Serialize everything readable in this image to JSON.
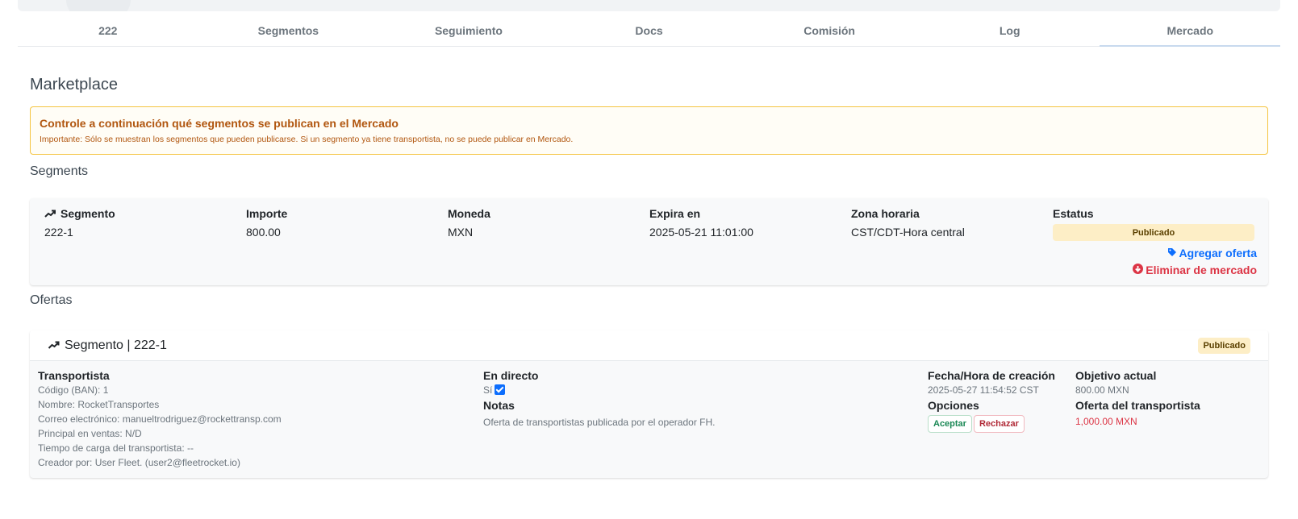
{
  "tabs": [
    "222",
    "Segmentos",
    "Seguimiento",
    "Docs",
    "Comisión",
    "Log",
    "Mercado"
  ],
  "page_title": "Marketplace",
  "alert": {
    "title": "Controle a continuación qué segmentos se publican en el Mercado",
    "subtitle": "Importante: Sólo se muestran los segmentos que pueden publicarse. Si un segmento ya tiene transportista, no se puede publicar en Mercado."
  },
  "segments": {
    "section_label": "Segments",
    "headers": {
      "segmento": "Segmento",
      "importe": "Importe",
      "moneda": "Moneda",
      "expira": "Expira en",
      "zona": "Zona horaria",
      "estatus": "Estatus"
    },
    "row": {
      "segmento": "222-1",
      "importe": "800.00",
      "moneda": "MXN",
      "expira": "2025-05-21 11:01:00",
      "zona": "CST/CDT-Hora central",
      "estatus": "Publicado"
    },
    "actions": {
      "add": "Agregar oferta",
      "remove": "Eliminar de mercado"
    }
  },
  "offers": {
    "section_label": "Ofertas",
    "card_title": "Segmento | 222-1",
    "card_badge": "Publicado",
    "transportista": {
      "label": "Transportista",
      "lines": [
        "Código (BAN): 1",
        "Nombre: RocketTransportes",
        "Correo electrónico: manueltrodriguez@rockettransp.com",
        "Principal en ventas: N/D",
        "Tiempo de carga del transportista: --",
        "Creador por: User Fleet. (user2@fleetrocket.io)"
      ]
    },
    "en_directo": {
      "label": "En directo",
      "value": "Sí"
    },
    "notas": {
      "label": "Notas",
      "value": "Oferta de transportistas publicada por el operador FH."
    },
    "fecha": {
      "label": "Fecha/Hora de creación",
      "value": "2025-05-27 11:54:52 CST"
    },
    "opciones": {
      "label": "Opciones",
      "accept": "Aceptar",
      "reject": "Rechazar"
    },
    "objetivo": {
      "label": "Objetivo actual",
      "value": "800.00 MXN"
    },
    "oferta": {
      "label": "Oferta del transportista",
      "value": "1,000.00 MXN"
    }
  },
  "colors": {
    "alert_border": "#f5c542",
    "alert_text": "#b1560f",
    "badge_bg": "#fdeec6",
    "link_blue": "#0d6efd",
    "danger_red": "#dc3545"
  }
}
